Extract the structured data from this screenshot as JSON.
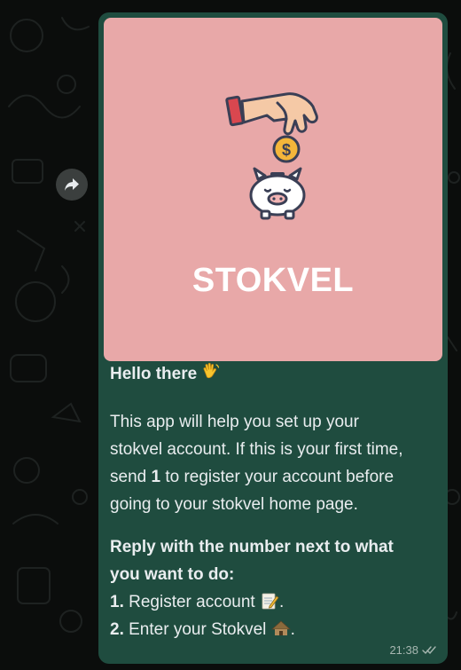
{
  "message": {
    "media": {
      "brand_title": "STOKVEL"
    },
    "greeting": "Hello there",
    "paragraph": {
      "line1": "This app will help you set up your",
      "line2": "stokvel account. If this is your first time,",
      "line3_a": "send ",
      "line3_num": "1",
      "line3_b": " to register your account before",
      "line4": "going to your stokvel home page."
    },
    "prompt": {
      "line1": "Reply with the number next to what",
      "line2": "you want to do:"
    },
    "options": [
      {
        "number": "1.",
        "label": " Register account ",
        "end": "."
      },
      {
        "number": "2.",
        "label": " Enter your Stokvel ",
        "end": "."
      }
    ],
    "time": "21:38"
  },
  "icons": {
    "forward": "forward-arrow-icon",
    "wave": "waving-hand-icon",
    "memo": "memo-icon",
    "hut": "hut-icon",
    "ticks": "double-check-icon",
    "hand_coin": "hand-with-coin-icon",
    "piggy": "piggy-bank-icon"
  },
  "colors": {
    "bubble": "#1f4c3f",
    "media_background": "#e8a8a8",
    "text": "#e9edef",
    "wallpaper": "#0b0d0c"
  }
}
